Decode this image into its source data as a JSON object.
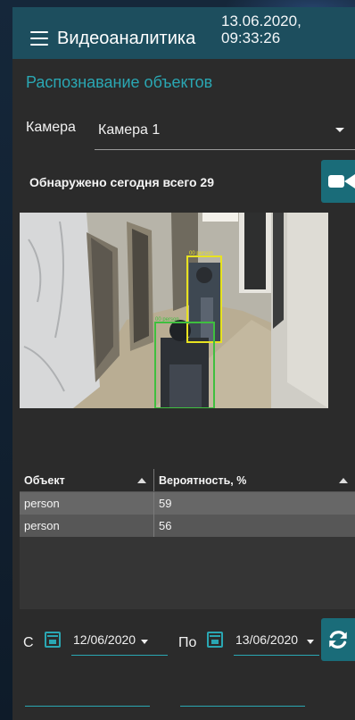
{
  "header": {
    "title": "Видеоаналитика",
    "datetime_line1": "13.06.2020,",
    "datetime_line2": "09:33:26"
  },
  "section": {
    "title": "Распознавание объектов"
  },
  "camera": {
    "label": "Камера",
    "selected": "Камера 1"
  },
  "detected": {
    "text": "Обнаружено сегодня всего 29"
  },
  "camera_view": {
    "detections": [
      {
        "label": "person",
        "color": "#e8e320"
      },
      {
        "label": "person",
        "color": "#3fbf3f"
      }
    ]
  },
  "table": {
    "columns": [
      "Объект",
      "Вероятность, %"
    ],
    "rows": [
      {
        "object": "person",
        "probability": "59"
      },
      {
        "object": "person",
        "probability": "56"
      }
    ]
  },
  "filters": {
    "from_label": "С",
    "from_value": "12/06/2020",
    "to_label": "По",
    "to_value": "13/06/2020"
  },
  "colors": {
    "accent": "#2aa7b3",
    "header_bg": "#1d4e5e",
    "button_bg": "#1a6c79",
    "panel_bg": "#2b2b2b"
  },
  "icons": [
    "menu-icon",
    "dropdown-caret-icon",
    "video-camera-icon",
    "sort-asc-icon",
    "calendar-icon",
    "refresh-icon"
  ]
}
